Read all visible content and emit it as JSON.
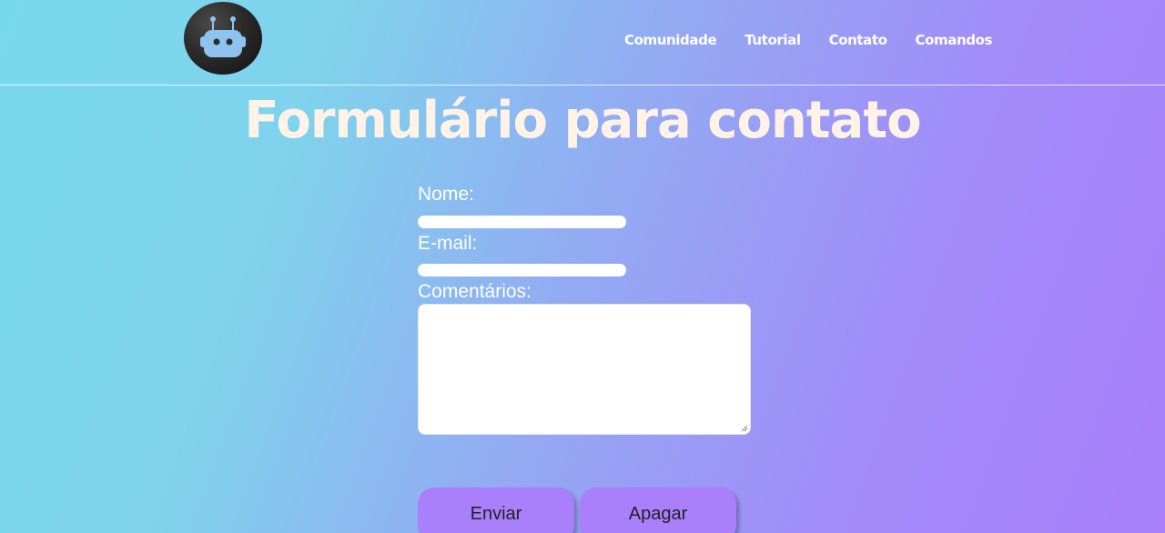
{
  "header": {
    "logo_icon": "robot-icon",
    "nav": [
      {
        "label": "Comunidade"
      },
      {
        "label": "Tutorial"
      },
      {
        "label": "Contato"
      },
      {
        "label": "Comandos"
      }
    ]
  },
  "main": {
    "title": "Formulário para contato",
    "form": {
      "name_label": "Nome:",
      "name_value": "",
      "email_label": "E-mail:",
      "email_value": "",
      "comments_label": "Comentários:",
      "comments_value": "",
      "submit_label": "Enviar",
      "reset_label": "Apagar"
    }
  },
  "colors": {
    "accent": "#a97ffb",
    "gradient_start": "#79d9ec",
    "gradient_end": "#a97ffb",
    "title_color": "#fff3e8"
  }
}
